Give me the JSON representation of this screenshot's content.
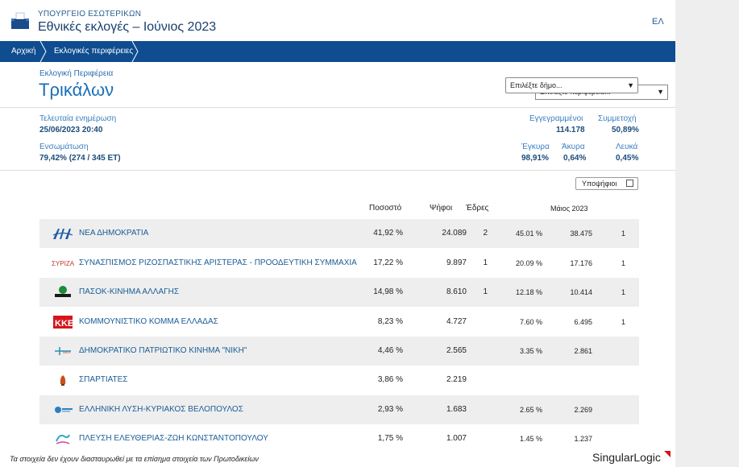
{
  "header": {
    "ministry": "ΥΠΟΥΡΓΕΙΟ ΕΣΩΤΕΡΙΚΩΝ",
    "title": "Εθνικές εκλογές – Ιούνιος 2023",
    "lang": "ΕΛ"
  },
  "nav": {
    "crumbs": [
      "Αρχική",
      "Εκλογικές περιφέρειες"
    ],
    "region_select": "Επιλέξτε περιφέρεια..."
  },
  "region": {
    "label": "Εκλογική Περιφέρεια",
    "name": "Τρικάλων",
    "municipality_select": "Επιλέξτε δήμο..."
  },
  "info": {
    "last_update_label": "Τελευταία ενημέρωση",
    "last_update_value": "25/06/2023 20:40",
    "integration_label": "Ενσωμάτωση",
    "integration_value": "79,42% (274 / 345 ΕΤ)",
    "registered_label": "Εγγεγραμμένοι",
    "registered_value": "114.178",
    "turnout_label": "Συμμετοχή",
    "turnout_value": "50,89%",
    "valid_label": "Έγκυρα",
    "valid_value": "98,91%",
    "invalid_label": "Άκυρα",
    "invalid_value": "0,64%",
    "blank_label": "Λευκά",
    "blank_value": "0,45%"
  },
  "candidates_toggle": "Υποψήφιοι",
  "table": {
    "headers": {
      "percent": "Ποσοστό",
      "votes": "Ψήφοι",
      "seats": "Έδρες",
      "may": "Μάιος 2023"
    },
    "rows": [
      {
        "name": "ΝΕΑ ΔΗΜΟΚΡΑΤΙΑ",
        "logo": "nd-logo",
        "percent": "41,92 %",
        "votes": "24.089",
        "seats": "2",
        "may_percent": "45.01 %",
        "may_votes": "38.475",
        "may_seats": "1"
      },
      {
        "name": "ΣΥΝΑΣΠΙΣΜΟΣ ΡΙΖΟΣΠΑΣΤΙΚΗΣ ΑΡΙΣΤΕΡΑΣ - ΠΡΟΟΔΕΥΤΙΚΗ ΣΥΜΜΑΧΙΑ",
        "logo": "syriza-logo",
        "percent": "17,22 %",
        "votes": "9.897",
        "seats": "1",
        "may_percent": "20.09 %",
        "may_votes": "17.176",
        "may_seats": "1"
      },
      {
        "name": "ΠΑΣΟΚ-ΚΙΝΗΜΑ ΑΛΛΑΓΗΣ",
        "logo": "pasok-logo",
        "percent": "14,98 %",
        "votes": "8.610",
        "seats": "1",
        "may_percent": "12.18 %",
        "may_votes": "10.414",
        "may_seats": "1"
      },
      {
        "name": "ΚΟΜΜΟΥΝΙΣΤΙΚΟ ΚΟΜΜΑ ΕΛΛΑΔΑΣ",
        "logo": "kke-logo",
        "percent": "8,23 %",
        "votes": "4.727",
        "seats": "",
        "may_percent": "7.60 %",
        "may_votes": "6.495",
        "may_seats": "1"
      },
      {
        "name": "ΔΗΜΟΚΡΑΤΙΚΟ ΠΑΤΡΙΩΤΙΚΟ ΚΙΝΗΜΑ \"ΝΙΚΗ\"",
        "logo": "niki-logo",
        "percent": "4,46 %",
        "votes": "2.565",
        "seats": "",
        "may_percent": "3.35 %",
        "may_votes": "2.861",
        "may_seats": ""
      },
      {
        "name": "ΣΠΑΡΤΙΑΤΕΣ",
        "logo": "spartiates-logo",
        "percent": "3,86 %",
        "votes": "2.219",
        "seats": "",
        "may_percent": "",
        "may_votes": "",
        "may_seats": ""
      },
      {
        "name": "ΕΛΛΗΝΙΚΗ ΛΥΣΗ-ΚΥΡΙΑΚΟΣ ΒΕΛΟΠΟΥΛΟΣ",
        "logo": "elliniki-lysi-logo",
        "percent": "2,93 %",
        "votes": "1.683",
        "seats": "",
        "may_percent": "2.65 %",
        "may_votes": "2.269",
        "may_seats": ""
      },
      {
        "name": "ΠΛΕΥΣΗ ΕΛΕΥΘΕΡΙΑΣ-ΖΩΗ ΚΩΝΣΤΑΝΤΟΠΟΥΛΟΥ",
        "logo": "plefsi-logo",
        "percent": "1,75 %",
        "votes": "1.007",
        "seats": "",
        "may_percent": "1.45 %",
        "may_votes": "1.237",
        "may_seats": ""
      }
    ]
  },
  "footer": {
    "note": "Τα στοιχεία δεν έχουν διασταυρωθεί με τα επίσημα στοιχεία των Πρωτοδικείων",
    "brand": "SingularLogic"
  },
  "colors": {
    "nav": "#0f4c90",
    "row_alt": "#eeeeee",
    "link": "#1a5c96"
  }
}
